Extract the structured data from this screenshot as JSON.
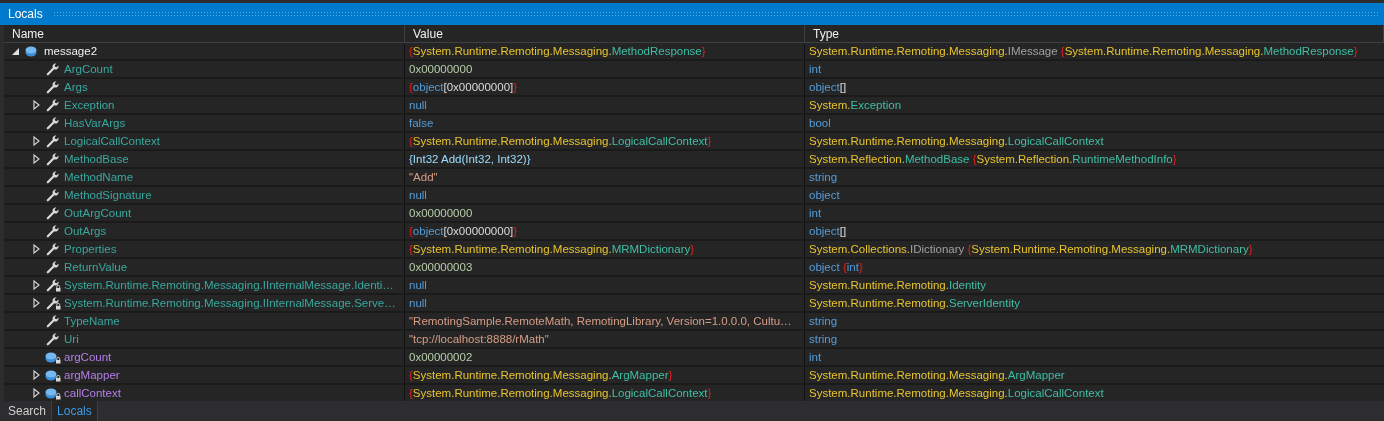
{
  "window": {
    "title": "Locals"
  },
  "columns": [
    "Name",
    "Value",
    "Type"
  ],
  "locals": [
    {
      "name": "message2",
      "kind": "local",
      "expandable": true,
      "expanded": true,
      "value": [
        {
          "kind": "brace",
          "text": "{"
        },
        {
          "kind": "ns",
          "text": "System.Runtime.Remoting.Messaging."
        },
        {
          "kind": "type",
          "text": "MethodResponse"
        },
        {
          "kind": "brace",
          "text": "}"
        }
      ],
      "type": [
        {
          "kind": "ns",
          "text": "System.Runtime.Remoting.Messaging."
        },
        {
          "kind": "iface",
          "text": "IMessage "
        },
        {
          "kind": "brace",
          "text": "{"
        },
        {
          "kind": "ns",
          "text": "System.Runtime.Remoting.Messaging."
        },
        {
          "kind": "type",
          "text": "MethodResponse"
        },
        {
          "kind": "brace",
          "text": "}"
        }
      ],
      "children": [
        {
          "name": "ArgCount",
          "kind": "property",
          "expandable": false,
          "value": [
            {
              "kind": "num",
              "text": "0x00000000"
            }
          ],
          "type": [
            {
              "kind": "kw",
              "text": "int"
            }
          ]
        },
        {
          "name": "Args",
          "kind": "property",
          "expandable": false,
          "value": [
            {
              "kind": "brace",
              "text": "{"
            },
            {
              "kind": "kw",
              "text": "object"
            },
            {
              "kind": "plain",
              "text": "[0x00000000]"
            },
            {
              "kind": "brace",
              "text": "}"
            }
          ],
          "type": [
            {
              "kind": "kw",
              "text": "object"
            },
            {
              "kind": "plain",
              "text": "[]"
            }
          ]
        },
        {
          "name": "Exception",
          "kind": "property",
          "expandable": true,
          "expanded": false,
          "value": [
            {
              "kind": "kw",
              "text": "null"
            }
          ],
          "type": [
            {
              "kind": "ns",
              "text": "System."
            },
            {
              "kind": "type",
              "text": "Exception"
            }
          ]
        },
        {
          "name": "HasVarArgs",
          "kind": "property",
          "expandable": false,
          "value": [
            {
              "kind": "kw",
              "text": "false"
            }
          ],
          "type": [
            {
              "kind": "kw",
              "text": "bool"
            }
          ]
        },
        {
          "name": "LogicalCallContext",
          "kind": "property",
          "expandable": true,
          "expanded": false,
          "value": [
            {
              "kind": "brace",
              "text": "{"
            },
            {
              "kind": "ns",
              "text": "System.Runtime.Remoting.Messaging."
            },
            {
              "kind": "type",
              "text": "LogicalCallContext"
            },
            {
              "kind": "brace",
              "text": "}"
            }
          ],
          "type": [
            {
              "kind": "ns",
              "text": "System.Runtime.Remoting.Messaging."
            },
            {
              "kind": "type",
              "text": "LogicalCallContext"
            }
          ]
        },
        {
          "name": "MethodBase",
          "kind": "property",
          "expandable": true,
          "expanded": false,
          "value": [
            {
              "kind": "method",
              "text": "{Int32 Add(Int32, Int32)}"
            }
          ],
          "type": [
            {
              "kind": "ns",
              "text": "System.Reflection."
            },
            {
              "kind": "type",
              "text": "MethodBase "
            },
            {
              "kind": "brace",
              "text": "{"
            },
            {
              "kind": "ns",
              "text": "System.Reflection."
            },
            {
              "kind": "type",
              "text": "RuntimeMethodInfo"
            },
            {
              "kind": "brace",
              "text": "}"
            }
          ]
        },
        {
          "name": "MethodName",
          "kind": "property",
          "expandable": false,
          "value": [
            {
              "kind": "str",
              "text": "\"Add\""
            }
          ],
          "type": [
            {
              "kind": "kw",
              "text": "string"
            }
          ]
        },
        {
          "name": "MethodSignature",
          "kind": "property",
          "expandable": false,
          "value": [
            {
              "kind": "kw",
              "text": "null"
            }
          ],
          "type": [
            {
              "kind": "kw",
              "text": "object"
            }
          ]
        },
        {
          "name": "OutArgCount",
          "kind": "property",
          "expandable": false,
          "value": [
            {
              "kind": "num",
              "text": "0x00000000"
            }
          ],
          "type": [
            {
              "kind": "kw",
              "text": "int"
            }
          ]
        },
        {
          "name": "OutArgs",
          "kind": "property",
          "expandable": false,
          "value": [
            {
              "kind": "brace",
              "text": "{"
            },
            {
              "kind": "kw",
              "text": "object"
            },
            {
              "kind": "plain",
              "text": "[0x00000000]"
            },
            {
              "kind": "brace",
              "text": "}"
            }
          ],
          "type": [
            {
              "kind": "kw",
              "text": "object"
            },
            {
              "kind": "plain",
              "text": "[]"
            }
          ]
        },
        {
          "name": "Properties",
          "kind": "property",
          "expandable": true,
          "expanded": false,
          "value": [
            {
              "kind": "brace",
              "text": "{"
            },
            {
              "kind": "ns",
              "text": "System.Runtime.Remoting.Messaging."
            },
            {
              "kind": "type",
              "text": "MRMDictionary"
            },
            {
              "kind": "brace",
              "text": "}"
            }
          ],
          "type": [
            {
              "kind": "ns",
              "text": "System.Collections."
            },
            {
              "kind": "iface",
              "text": "IDictionary "
            },
            {
              "kind": "brace",
              "text": "{"
            },
            {
              "kind": "ns",
              "text": "System.Runtime.Remoting.Messaging."
            },
            {
              "kind": "type",
              "text": "MRMDictionary"
            },
            {
              "kind": "brace",
              "text": "}"
            }
          ]
        },
        {
          "name": "ReturnValue",
          "kind": "property",
          "expandable": false,
          "value": [
            {
              "kind": "num",
              "text": "0x00000003"
            }
          ],
          "type": [
            {
              "kind": "kw",
              "text": "object "
            },
            {
              "kind": "brace",
              "text": "{"
            },
            {
              "kind": "kw",
              "text": "int"
            },
            {
              "kind": "brace",
              "text": "}"
            }
          ]
        },
        {
          "name": "System.Runtime.Remoting.Messaging.IInternalMessage.Identi…",
          "kind": "property-private",
          "expandable": true,
          "expanded": false,
          "value": [
            {
              "kind": "kw",
              "text": "null"
            }
          ],
          "type": [
            {
              "kind": "ns",
              "text": "System.Runtime.Remoting."
            },
            {
              "kind": "type",
              "text": "Identity"
            }
          ]
        },
        {
          "name": "System.Runtime.Remoting.Messaging.IInternalMessage.Serve…",
          "kind": "property-private",
          "expandable": true,
          "expanded": false,
          "value": [
            {
              "kind": "kw",
              "text": "null"
            }
          ],
          "type": [
            {
              "kind": "ns",
              "text": "System.Runtime.Remoting."
            },
            {
              "kind": "type",
              "text": "ServerIdentity"
            }
          ]
        },
        {
          "name": "TypeName",
          "kind": "property",
          "expandable": false,
          "value": [
            {
              "kind": "str",
              "text": "\"RemotingSample.RemoteMath, RemotingLibrary, Version=1.0.0.0, Cultu…"
            }
          ],
          "type": [
            {
              "kind": "kw",
              "text": "string"
            }
          ]
        },
        {
          "name": "Uri",
          "kind": "property",
          "expandable": false,
          "value": [
            {
              "kind": "str",
              "text": "\"tcp://localhost:8888/rMath\""
            }
          ],
          "type": [
            {
              "kind": "kw",
              "text": "string"
            }
          ]
        },
        {
          "name": "argCount",
          "kind": "field-private",
          "expandable": false,
          "value": [
            {
              "kind": "num",
              "text": "0x00000002"
            }
          ],
          "type": [
            {
              "kind": "kw",
              "text": "int"
            }
          ]
        },
        {
          "name": "argMapper",
          "kind": "field-private",
          "expandable": true,
          "expanded": false,
          "value": [
            {
              "kind": "brace",
              "text": "{"
            },
            {
              "kind": "ns",
              "text": "System.Runtime.Remoting.Messaging."
            },
            {
              "kind": "type",
              "text": "ArgMapper"
            },
            {
              "kind": "brace",
              "text": "}"
            }
          ],
          "type": [
            {
              "kind": "ns",
              "text": "System.Runtime.Remoting.Messaging."
            },
            {
              "kind": "type",
              "text": "ArgMapper"
            }
          ]
        },
        {
          "name": "callContext",
          "kind": "field-private",
          "expandable": true,
          "expanded": false,
          "value": [
            {
              "kind": "brace",
              "text": "{"
            },
            {
              "kind": "ns",
              "text": "System.Runtime.Remoting.Messaging."
            },
            {
              "kind": "type",
              "text": "LogicalCallContext"
            },
            {
              "kind": "brace",
              "text": "}"
            }
          ],
          "type": [
            {
              "kind": "ns",
              "text": "System.Runtime.Remoting.Messaging."
            },
            {
              "kind": "type",
              "text": "LogicalCallContext"
            }
          ]
        }
      ]
    }
  ],
  "bottom_tabs": [
    {
      "label": "Search",
      "selected": false
    },
    {
      "label": "Locals",
      "selected": true
    }
  ]
}
